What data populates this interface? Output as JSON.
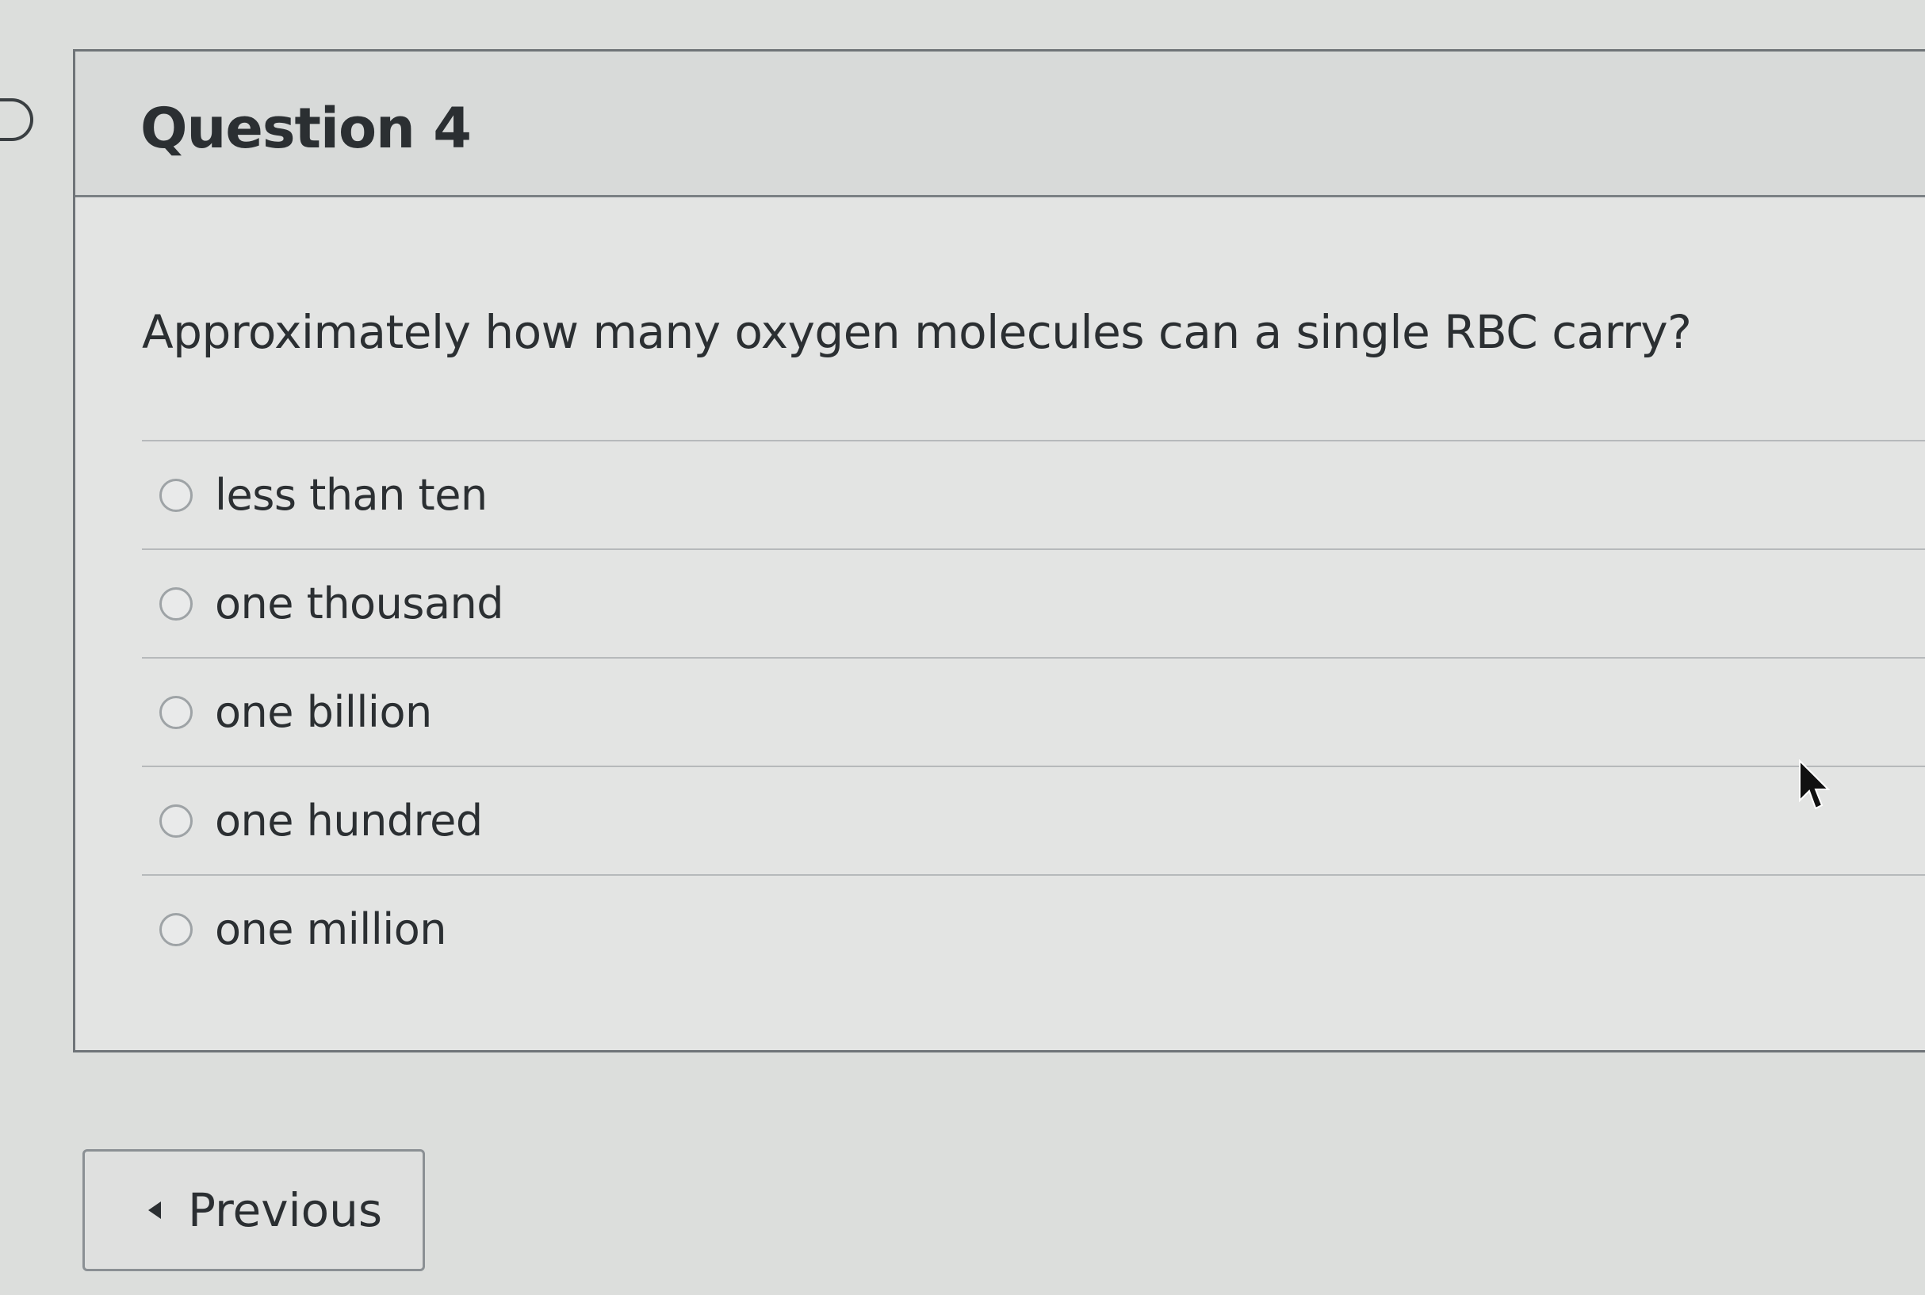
{
  "question": {
    "title": "Question 4",
    "text": "Approximately how many oxygen molecules can a single RBC carry?",
    "answers": [
      {
        "label": "less than ten"
      },
      {
        "label": "one thousand"
      },
      {
        "label": "one billion"
      },
      {
        "label": "one hundred"
      },
      {
        "label": "one million"
      }
    ]
  },
  "navigation": {
    "previous_label": "Previous"
  },
  "icons": {
    "flag": "flag-icon",
    "previous": "chevron-left-icon",
    "cursor": "mouse-pointer-icon"
  }
}
